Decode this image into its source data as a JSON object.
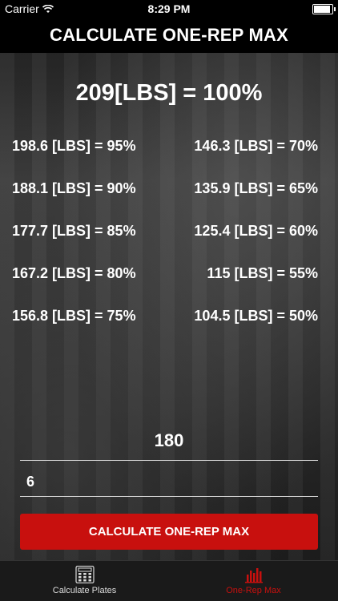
{
  "status": {
    "carrier": "Carrier",
    "time": "8:29 PM"
  },
  "nav": {
    "title": "CALCULATE ONE-REP MAX"
  },
  "one_rep_max": "209[LBS] = 100%",
  "percent_rows": [
    {
      "left": "198.6 [LBS] = 95%",
      "right": "146.3 [LBS] = 70%"
    },
    {
      "left": "188.1 [LBS] = 90%",
      "right": "135.9 [LBS] = 65%"
    },
    {
      "left": "177.7 [LBS] = 85%",
      "right": "125.4 [LBS] = 60%"
    },
    {
      "left": "167.2 [LBS] = 80%",
      "right": "115 [LBS] = 55%"
    },
    {
      "left": "156.8 [LBS] = 75%",
      "right": "104.5 [LBS] = 50%"
    }
  ],
  "inputs": {
    "weight_value": "180",
    "reps_value": "6"
  },
  "button": {
    "label": "CALCULATE ONE-REP MAX"
  },
  "tabs": [
    {
      "label": "Calculate Plates",
      "icon": "calculator-icon"
    },
    {
      "label": "One-Rep Max",
      "icon": "bar-chart-icon"
    }
  ],
  "colors": {
    "accent": "#c8100e",
    "bar_bg": "#000000",
    "tab_bg": "#1a1a1a"
  }
}
